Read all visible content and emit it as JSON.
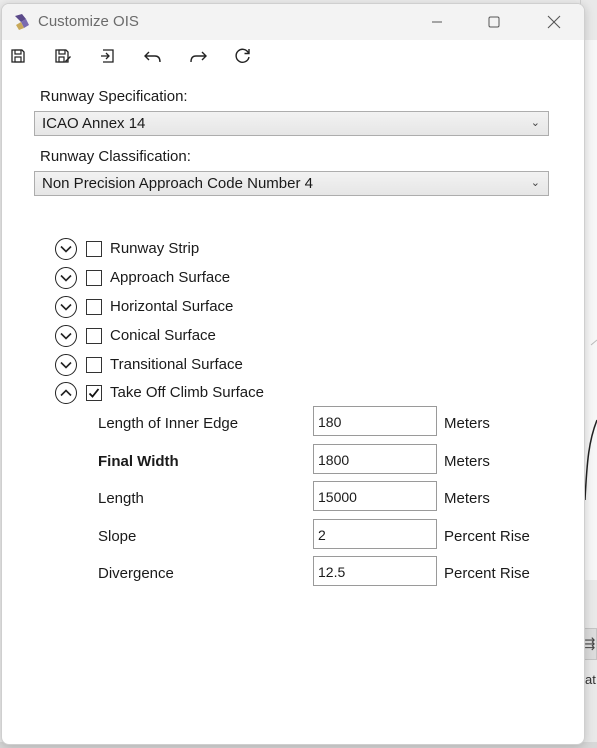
{
  "window": {
    "title": "Customize OIS"
  },
  "toolbar": {
    "icons": [
      "save-icon",
      "save-as-icon",
      "import-icon",
      "undo-icon",
      "redo-icon",
      "refresh-icon"
    ]
  },
  "runway_spec": {
    "label": "Runway Specification:",
    "value": "ICAO Annex 14"
  },
  "runway_class": {
    "label": "Runway Classification:",
    "value": "Non Precision Approach Code Number 4"
  },
  "surfaces": [
    {
      "label": "Runway Strip",
      "checked": false,
      "expanded": false
    },
    {
      "label": "Approach Surface",
      "checked": false,
      "expanded": false
    },
    {
      "label": "Horizontal Surface",
      "checked": false,
      "expanded": false
    },
    {
      "label": "Conical Surface",
      "checked": false,
      "expanded": false
    },
    {
      "label": "Transitional Surface",
      "checked": false,
      "expanded": false
    },
    {
      "label": "Take Off Climb Surface",
      "checked": true,
      "expanded": true
    }
  ],
  "params": [
    {
      "label": "Length of Inner Edge",
      "value": "180",
      "unit": "Meters"
    },
    {
      "label": "Final Width",
      "value": "1800",
      "unit": "Meters"
    },
    {
      "label": "Length",
      "value": "15000",
      "unit": "Meters"
    },
    {
      "label": "Slope",
      "value": "2",
      "unit": "Percent Rise"
    },
    {
      "label": "Divergence",
      "value": "12.5",
      "unit": "Percent Rise"
    }
  ],
  "background": {
    "fragment_text": "at"
  }
}
